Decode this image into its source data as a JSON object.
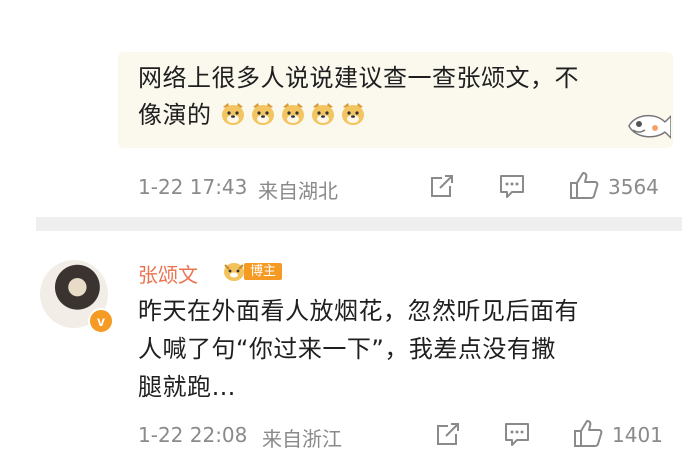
{
  "comment1": {
    "text_line1": "网络上很多人说说建议查一查张颂文，不",
    "text_line2": "像演的",
    "emoji_count": 5,
    "time": "1-22 17:43",
    "location": "来自湖北",
    "likes": "3564"
  },
  "comment2": {
    "username": "张颂文",
    "badge": "博主",
    "verified_mark": "v",
    "text_line1": "昨天在外面看人放烟花，忽然听见后面有",
    "text_line2": "人喊了句“你过来一下”，我差点没有撒",
    "text_line3": "腿就跑…",
    "time": "1-22 22:08",
    "location": "来自浙江",
    "likes": "1401"
  },
  "colors": {
    "username": "#eb7350",
    "meta": "#8a8a8a",
    "divider": "#efefef",
    "badge": "#f59a23"
  }
}
